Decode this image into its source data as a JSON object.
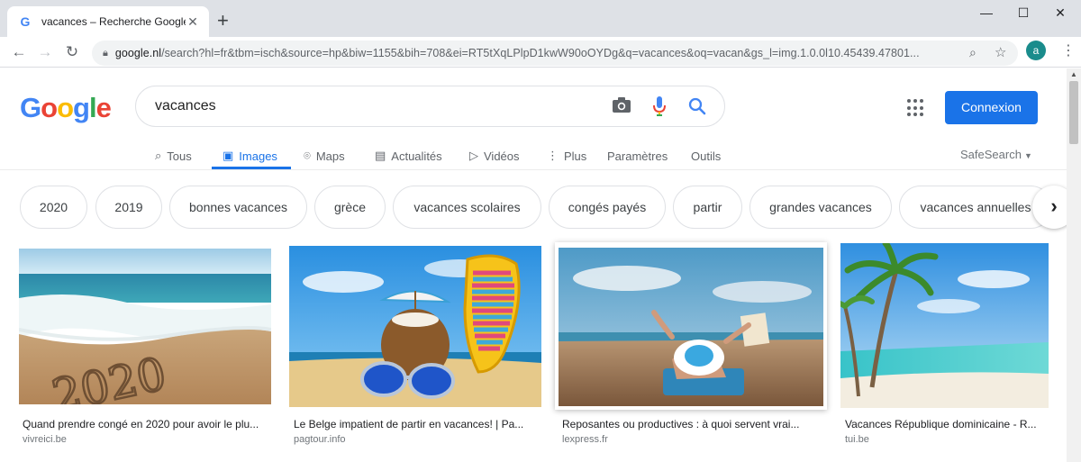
{
  "browser": {
    "tab_title": "vacances – Recherche Google",
    "tab_favicon": "G",
    "new_tab": "+",
    "url_host": "google.nl",
    "url_rest": "/search?hl=fr&tbm=isch&source=hp&biw=1155&bih=708&ei=RT5tXqLPlpD1kwW90oOYDg&q=vacances&oq=vacan&gs_l=img.1.0.0l10.45439.47801...",
    "avatar_letter": "a"
  },
  "google": {
    "logo_letters": [
      "G",
      "o",
      "o",
      "g",
      "l",
      "e"
    ],
    "logo_colors": [
      "#4285f4",
      "#ea4335",
      "#fbbc05",
      "#4285f4",
      "#34a853",
      "#ea4335"
    ],
    "query": "vacances",
    "signin": "Connexion",
    "tabs": [
      {
        "label": "Tous",
        "icon": "search-icon"
      },
      {
        "label": "Images",
        "icon": "image-icon"
      },
      {
        "label": "Maps",
        "icon": "map-pin-icon"
      },
      {
        "label": "Actualités",
        "icon": "news-icon"
      },
      {
        "label": "Vidéos",
        "icon": "video-icon"
      },
      {
        "label": "Plus",
        "icon": "more-vert-icon"
      },
      {
        "label": "Paramètres",
        "icon": ""
      },
      {
        "label": "Outils",
        "icon": ""
      }
    ],
    "safesearch": "SafeSearch",
    "chips": [
      "2020",
      "2019",
      "bonnes vacances",
      "grèce",
      "vacances scolaires",
      "congés payés",
      "partir",
      "grandes vacances",
      "vacances annuelles"
    ],
    "results": [
      {
        "title": "Quand prendre congé en 2020 pour avoir le plu...",
        "source": "vivreici.be"
      },
      {
        "title": "Le Belge impatient de partir en vacances! | Pa...",
        "source": "pagtour.info"
      },
      {
        "title": "Reposantes ou productives : à quoi servent vrai...",
        "source": "lexpress.fr"
      },
      {
        "title": "Vacances République dominicaine - R...",
        "source": "tui.be"
      }
    ],
    "sand_text": "2020"
  }
}
